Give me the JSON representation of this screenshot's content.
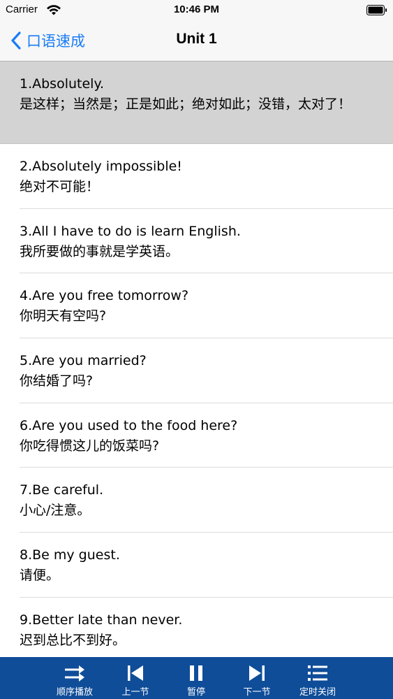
{
  "status_bar": {
    "carrier": "Carrier",
    "time": "10:46 PM"
  },
  "nav": {
    "back_label": "口语速成",
    "title": "Unit 1"
  },
  "phrases": [
    {
      "en": "1.Absolutely.",
      "zh": "是这样；当然是；正是如此；绝对如此；没错，太对了！",
      "selected": true
    },
    {
      "en": "2.Absolutely impossible!",
      "zh": "绝对不可能！"
    },
    {
      "en": "3.All I have to do is learn English.",
      "zh": "我所要做的事就是学英语。"
    },
    {
      "en": "4.Are you free tomorrow?",
      "zh": "你明天有空吗?"
    },
    {
      "en": "5.Are you married?",
      "zh": "你结婚了吗?"
    },
    {
      "en": "6.Are you used to the food here?",
      "zh": "你吃得惯这儿的饭菜吗?"
    },
    {
      "en": "7.Be careful.",
      "zh": "小心/注意。"
    },
    {
      "en": "8.Be my guest.",
      "zh": "请便。"
    },
    {
      "en": "9.Better late than never.",
      "zh": "迟到总比不到好。"
    }
  ],
  "toolbar": {
    "sequential": "顺序播放",
    "prev": "上一节",
    "pause": "暂停",
    "next": "下一节",
    "timer": "定时关闭"
  },
  "colors": {
    "accent": "#1a7cf5",
    "toolbar_bg": "#0f4d99",
    "selected_row": "#d3d3d3"
  }
}
